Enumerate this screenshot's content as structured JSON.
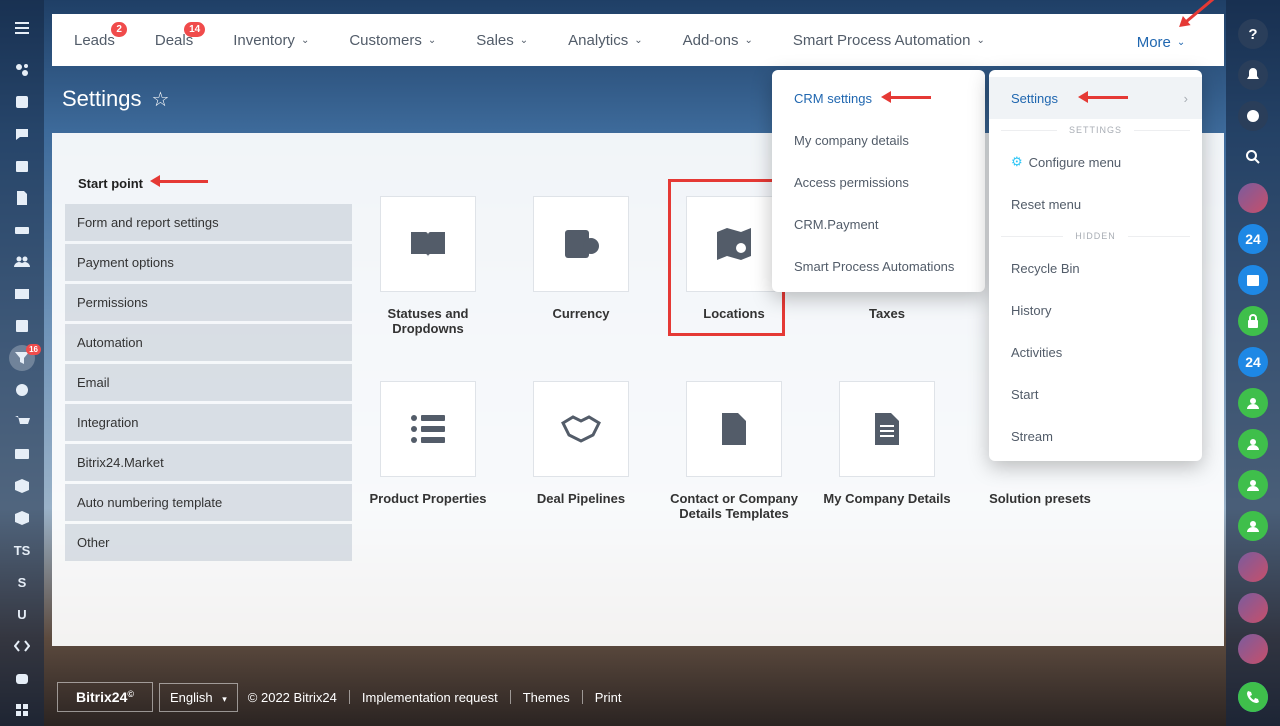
{
  "nav": {
    "items": [
      {
        "label": "Leads",
        "badge": "2",
        "chevron": false
      },
      {
        "label": "Deals",
        "badge": "14",
        "chevron": false
      },
      {
        "label": "Inventory",
        "badge": "",
        "chevron": true
      },
      {
        "label": "Customers",
        "badge": "",
        "chevron": true
      },
      {
        "label": "Sales",
        "badge": "",
        "chevron": true
      },
      {
        "label": "Analytics",
        "badge": "",
        "chevron": true
      },
      {
        "label": "Add-ons",
        "badge": "",
        "chevron": true
      },
      {
        "label": "Smart Process Automation",
        "badge": "",
        "chevron": true
      }
    ],
    "more_label": "More"
  },
  "page": {
    "title": "Settings"
  },
  "sidebar": {
    "start_point": "Start point",
    "items": [
      "Form and report settings",
      "Payment options",
      "Permissions",
      "Automation",
      "Email",
      "Integration",
      "Bitrix24.Market",
      "Auto numbering template",
      "Other"
    ]
  },
  "tiles": [
    {
      "label": "Statuses and Dropdowns",
      "icon": "book-icon"
    },
    {
      "label": "Currency",
      "icon": "currency-icon"
    },
    {
      "label": "Locations",
      "icon": "map-icon"
    },
    {
      "label": "Taxes",
      "icon": "taxes-icon"
    },
    {
      "label": "Product Properties",
      "icon": "list-icon"
    },
    {
      "label": "Deal Pipelines",
      "icon": "handshake-icon"
    },
    {
      "label": "Contact or Company Details Templates",
      "icon": "document-icon"
    },
    {
      "label": "My Company Details",
      "icon": "text-document-icon"
    },
    {
      "label": "Solution presets",
      "icon": "presets-icon"
    }
  ],
  "crm_menu": {
    "items": [
      "CRM settings",
      "My company details",
      "Access permissions",
      "CRM.Payment",
      "Smart Process Automations"
    ]
  },
  "more_menu": {
    "settings_label": "Settings",
    "section_settings": "SETTINGS",
    "configure": "Configure menu",
    "reset": "Reset menu",
    "section_hidden": "HIDDEN",
    "hidden_items": [
      "Recycle Bin",
      "History",
      "Activities",
      "Start",
      "Stream"
    ]
  },
  "left_rail": {
    "badge": "16",
    "ts": "TS",
    "s": "S",
    "u": "U"
  },
  "right_rail": {
    "b24": "24"
  },
  "footer": {
    "logo": "Bitrix24",
    "logo_mark": "©",
    "language": "English",
    "copyright": "© 2022 Bitrix24",
    "implementation": "Implementation request",
    "themes": "Themes",
    "print": "Print"
  },
  "colors": {
    "accent": "#2067b0",
    "badge": "#f04b4b",
    "annotation": "#e53935"
  }
}
